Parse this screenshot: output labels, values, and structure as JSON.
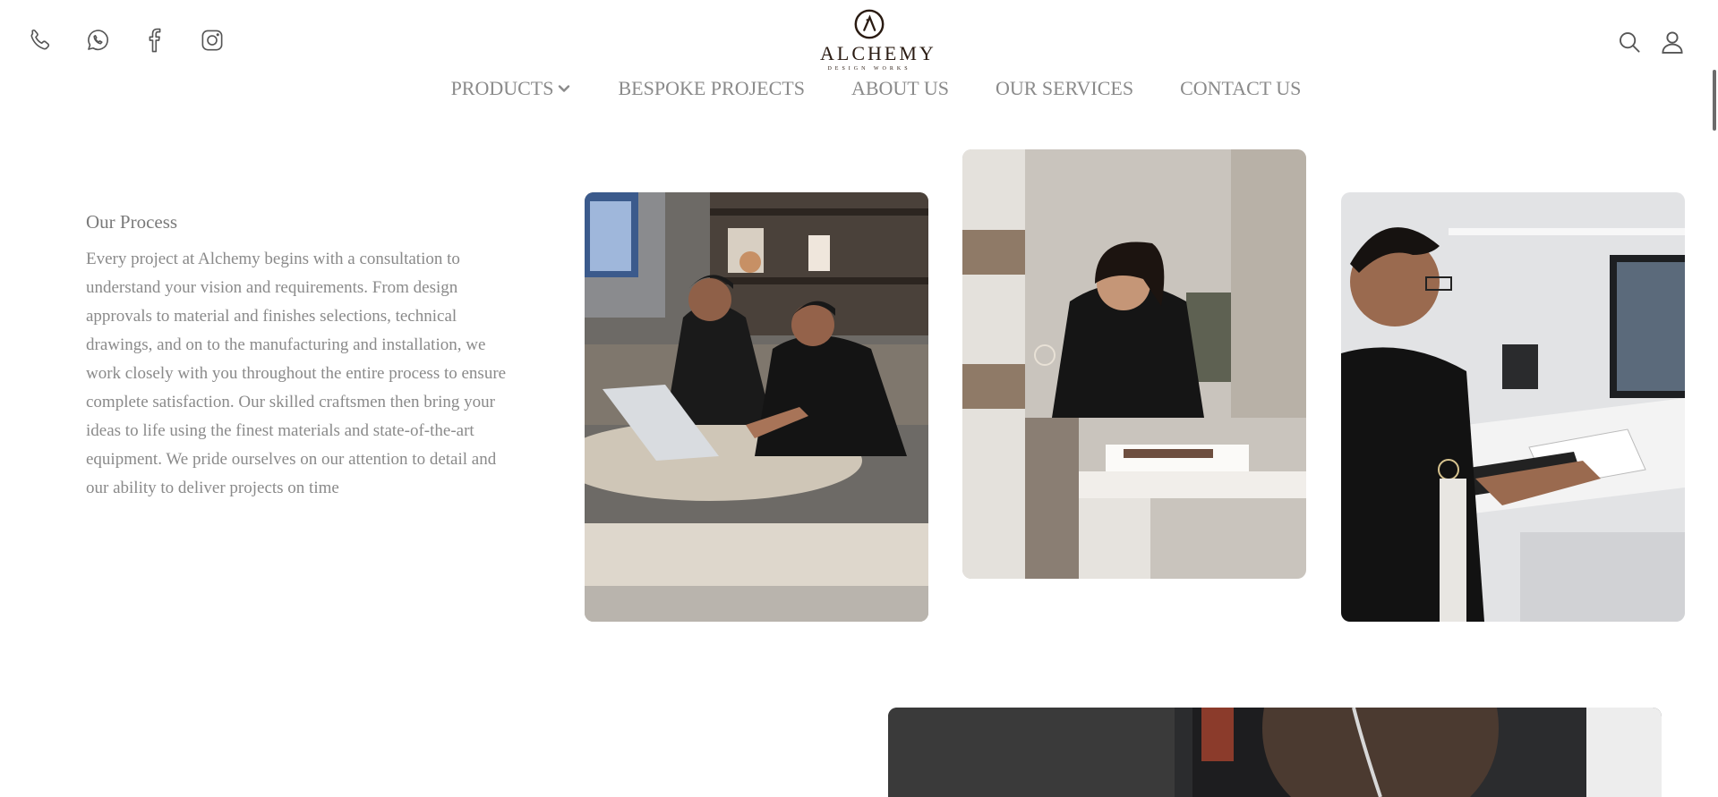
{
  "header": {
    "social_icons": [
      "phone-icon",
      "whatsapp-icon",
      "facebook-icon",
      "instagram-icon"
    ],
    "logo": {
      "name": "ALCHEMY",
      "tagline": "DESIGN WORKS"
    },
    "utility_icons": [
      "search-icon",
      "user-icon"
    ]
  },
  "nav": {
    "items": [
      {
        "label": "PRODUCTS",
        "has_dropdown": true
      },
      {
        "label": "BESPOKE PROJECTS"
      },
      {
        "label": "ABOUT US"
      },
      {
        "label": "OUR SERVICES"
      },
      {
        "label": "CONTACT US"
      }
    ]
  },
  "process": {
    "title": "Our Process",
    "body": "Every project at Alchemy begins with a consultation to understand your vision and requirements. From design approvals to material and finishes selections, technical drawings, and on to the manufacturing and installation, we work closely with you throughout the entire process to ensure complete satisfaction. Our skilled craftsmen then bring your ideas to life using the finest materials and state-of-the-art equipment. We pride ourselves on our attention to detail and our ability to deliver projects on time"
  },
  "colors": {
    "brand": "#2a1b12",
    "text": "#8a8a8a",
    "uniform": "#151515"
  }
}
